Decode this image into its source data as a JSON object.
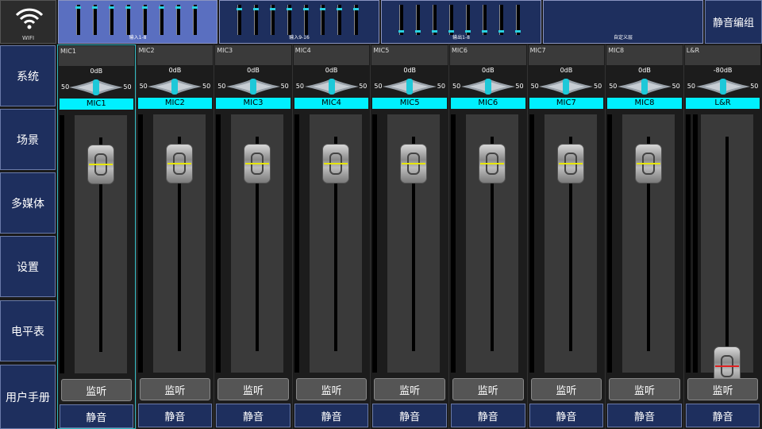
{
  "wifi": {
    "label": "WIFI"
  },
  "sidebar": {
    "items": [
      {
        "label": "系统"
      },
      {
        "label": "场景"
      },
      {
        "label": "多媒体"
      },
      {
        "label": "设置"
      },
      {
        "label": "电平表"
      },
      {
        "label": "用户手册"
      }
    ]
  },
  "banks": [
    {
      "label": "输入1-8",
      "bg": "#5a6fc0"
    },
    {
      "label": "输入9-16",
      "bg": "#1e2f5e"
    },
    {
      "label": "输出1-8",
      "bg": "#1e2f5e"
    },
    {
      "label": "自定义层",
      "bg": "#1e2f5e"
    }
  ],
  "mute_group": {
    "label": "静音编组"
  },
  "channels": [
    {
      "name": "MIC1",
      "label": "MIC1",
      "db": "0dB",
      "pan_l": "50",
      "pan_r": "50",
      "listen": "监听",
      "mute": "静音",
      "fader_level": 0.9,
      "selected": true
    },
    {
      "name": "MIC2",
      "label": "MIC2",
      "db": "0dB",
      "pan_l": "50",
      "pan_r": "50",
      "listen": "监听",
      "mute": "静音",
      "fader_level": 0.9
    },
    {
      "name": "MIC3",
      "label": "MIC3",
      "db": "0dB",
      "pan_l": "50",
      "pan_r": "50",
      "listen": "监听",
      "mute": "静音",
      "fader_level": 0.9
    },
    {
      "name": "MIC4",
      "label": "MIC4",
      "db": "0dB",
      "pan_l": "50",
      "pan_r": "50",
      "listen": "监听",
      "mute": "静音",
      "fader_level": 0.9
    },
    {
      "name": "MIC5",
      "label": "MIC5",
      "db": "0dB",
      "pan_l": "50",
      "pan_r": "50",
      "listen": "监听",
      "mute": "静音",
      "fader_level": 0.9
    },
    {
      "name": "MIC6",
      "label": "MIC6",
      "db": "0dB",
      "pan_l": "50",
      "pan_r": "50",
      "listen": "监听",
      "mute": "静音",
      "fader_level": 0.9
    },
    {
      "name": "MIC7",
      "label": "MIC7",
      "db": "0dB",
      "pan_l": "50",
      "pan_r": "50",
      "listen": "监听",
      "mute": "静音",
      "fader_level": 0.9
    },
    {
      "name": "MIC8",
      "label": "MIC8",
      "db": "0dB",
      "pan_l": "50",
      "pan_r": "50",
      "listen": "监听",
      "mute": "静音",
      "fader_level": 0.9
    },
    {
      "name": "L&R",
      "label": "L&R",
      "db": "-80dB",
      "pan_l": "50",
      "pan_r": "50",
      "listen": "监听",
      "mute": "静音",
      "fader_level": 0.0,
      "stereo": true
    }
  ],
  "colors": {
    "accent": "#00f0ff",
    "handle_line_normal": "#e6e600",
    "handle_line_master": "#e02020"
  }
}
